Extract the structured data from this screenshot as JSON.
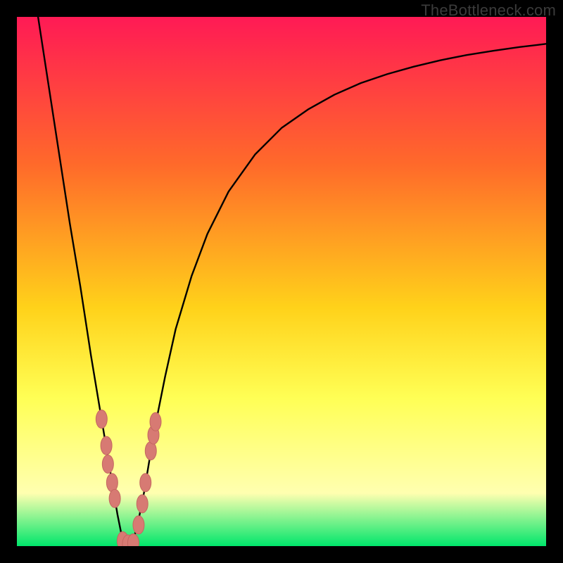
{
  "watermark": "TheBottleneck.com",
  "colors": {
    "frame": "#000000",
    "gradient_top": "#ff1a55",
    "gradient_mid1": "#ff6a2a",
    "gradient_mid2": "#ffd21a",
    "gradient_mid3": "#ffff55",
    "gradient_pale": "#ffffb0",
    "gradient_bottom": "#00e66b",
    "curve": "#000000",
    "marker_fill": "#d77a73",
    "marker_stroke": "#c46760"
  },
  "chart_data": {
    "type": "line",
    "title": "",
    "xlabel": "",
    "ylabel": "",
    "xlim": [
      0,
      100
    ],
    "ylim": [
      0,
      100
    ],
    "x": [
      4,
      6,
      8,
      10,
      12,
      14,
      15,
      16,
      17,
      18,
      19,
      20,
      21,
      22,
      23,
      24,
      25,
      26,
      28,
      30,
      33,
      36,
      40,
      45,
      50,
      55,
      60,
      65,
      70,
      75,
      80,
      85,
      90,
      95,
      100
    ],
    "y": [
      100,
      87,
      74,
      61,
      49,
      36,
      30,
      24,
      18,
      12,
      6,
      1,
      0,
      1,
      5,
      10,
      16,
      22,
      32,
      41,
      51,
      59,
      67,
      74,
      79,
      82.5,
      85.3,
      87.5,
      89.2,
      90.6,
      91.8,
      92.8,
      93.6,
      94.3,
      94.9
    ],
    "markers": [
      {
        "x": 16.0,
        "y": 24.0
      },
      {
        "x": 16.9,
        "y": 19.0
      },
      {
        "x": 17.2,
        "y": 15.5
      },
      {
        "x": 18.0,
        "y": 12.0
      },
      {
        "x": 18.5,
        "y": 9.0
      },
      {
        "x": 20.0,
        "y": 1.0
      },
      {
        "x": 21.0,
        "y": 0.4
      },
      {
        "x": 22.0,
        "y": 0.6
      },
      {
        "x": 23.0,
        "y": 4.0
      },
      {
        "x": 23.7,
        "y": 8.0
      },
      {
        "x": 24.3,
        "y": 12.0
      },
      {
        "x": 25.3,
        "y": 18.0
      },
      {
        "x": 25.8,
        "y": 21.0
      },
      {
        "x": 26.2,
        "y": 23.5
      }
    ]
  }
}
